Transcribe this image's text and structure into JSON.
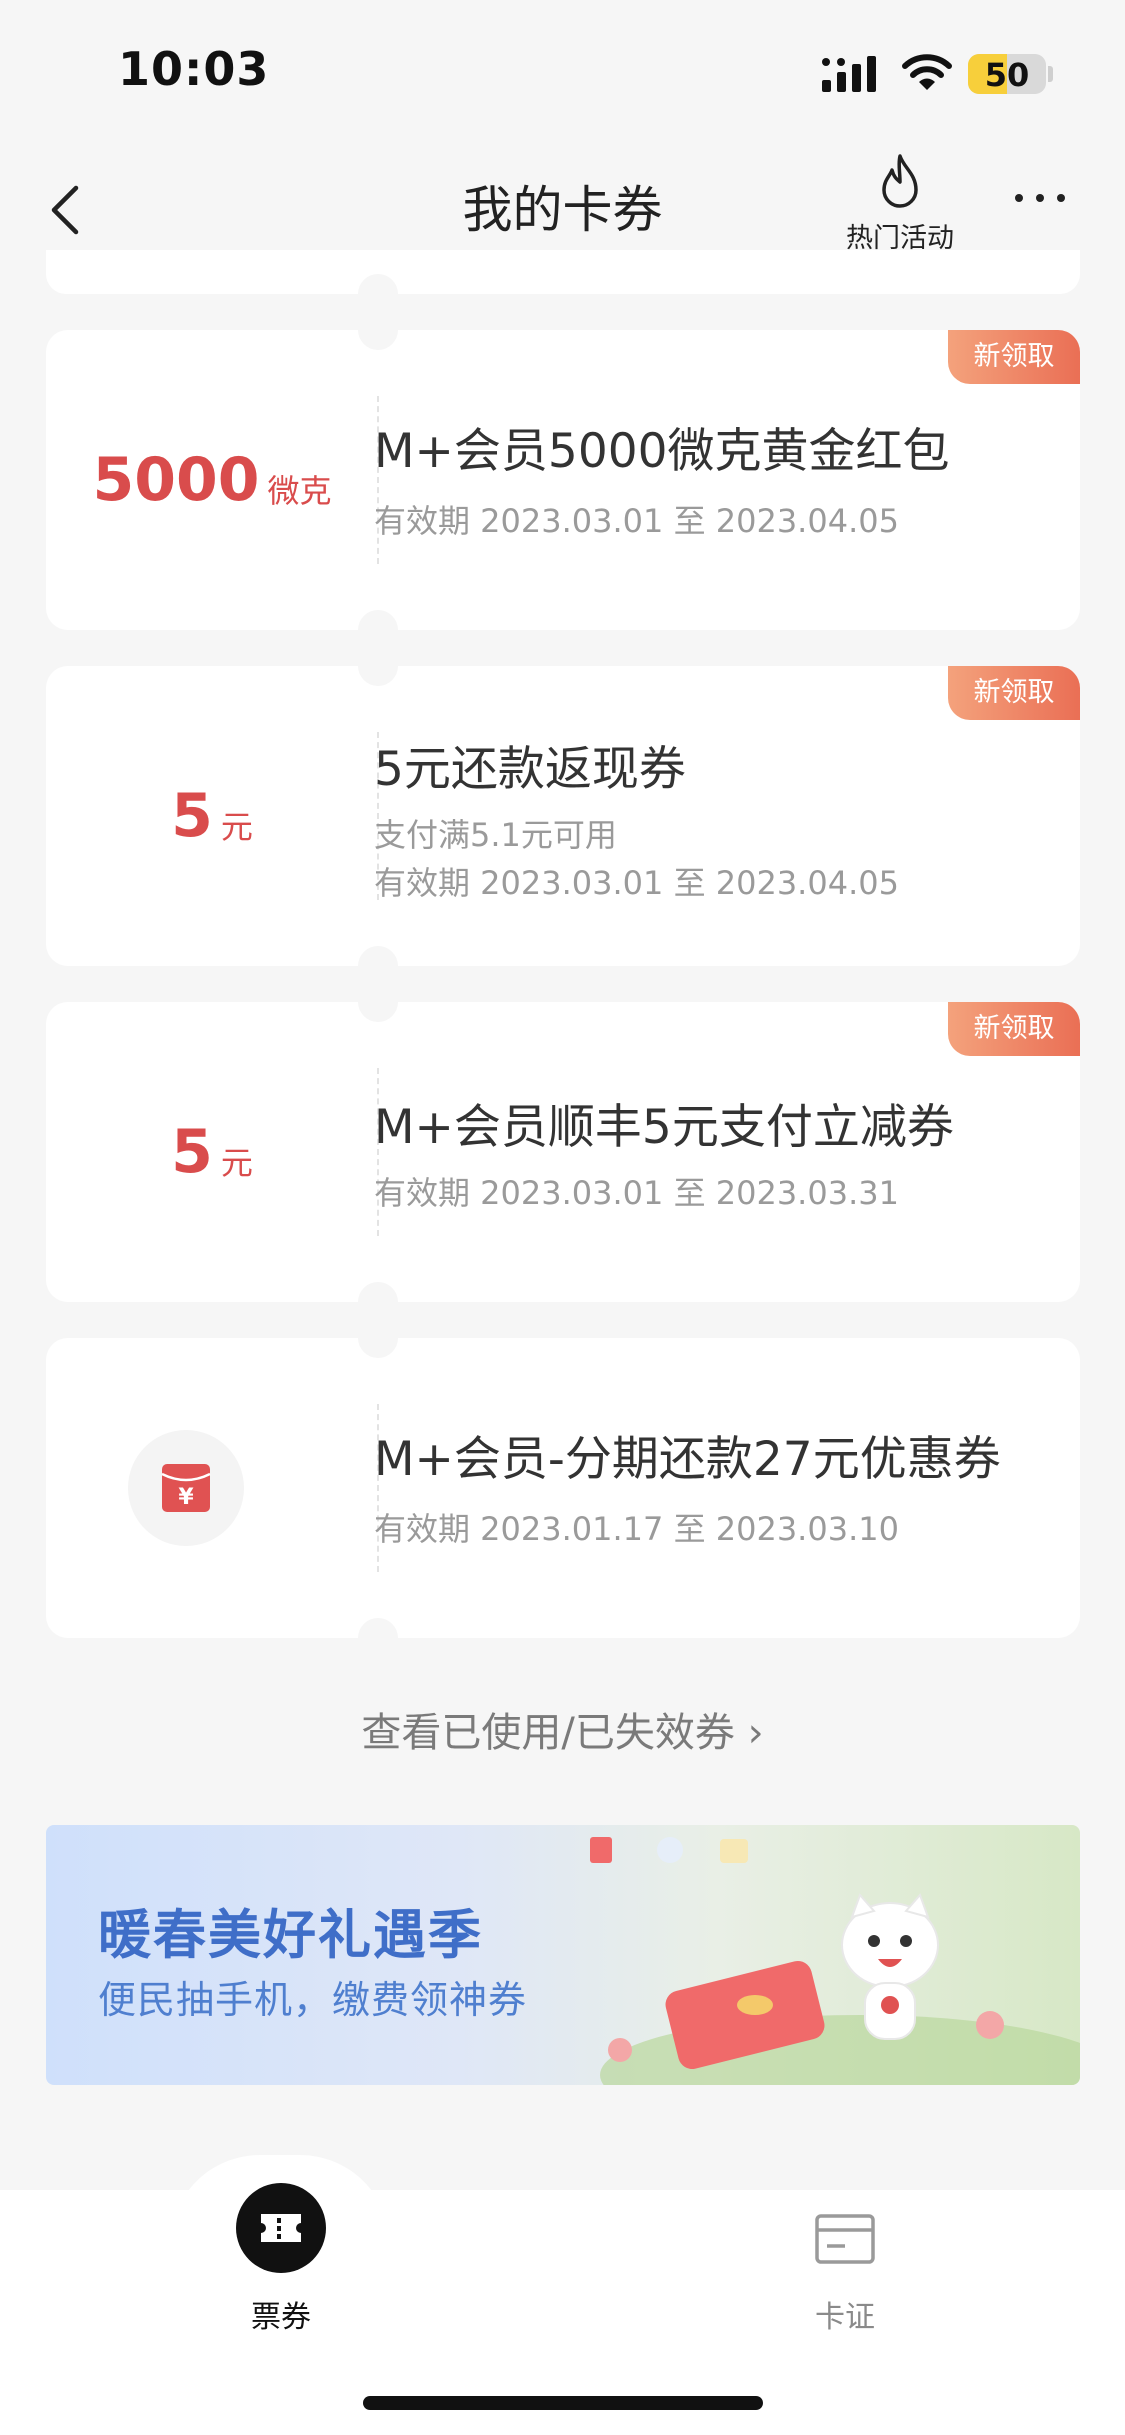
{
  "status_bar": {
    "time": "10:03",
    "battery": "50",
    "battery_level": 0.5
  },
  "nav": {
    "title": "我的卡券",
    "hot_label": "热门活动"
  },
  "coupons": [
    {
      "badge": "新领取",
      "amount": "5000",
      "unit": "微克",
      "title": "M+会员5000微克黄金红包",
      "condition": "",
      "validity": "有效期 2023.03.01 至 2023.04.05"
    },
    {
      "badge": "新领取",
      "amount": "5",
      "unit": "元",
      "title": "5元还款返现券",
      "condition": "支付满5.1元可用",
      "validity": "有效期 2023.03.01 至 2023.04.05"
    },
    {
      "badge": "新领取",
      "amount": "5",
      "unit": "元",
      "title": "M+会员顺丰5元支付立减券",
      "condition": "",
      "validity": "有效期 2023.03.01 至 2023.03.31"
    },
    {
      "badge": "",
      "amount": "",
      "unit": "",
      "title": "M+会员-分期还款27元优惠券",
      "condition": "",
      "validity": "有效期 2023.01.17 至 2023.03.10"
    }
  ],
  "view_used": "查看已使用/已失效券 ›",
  "banner": {
    "title": "暖春美好礼遇季",
    "subtitle": "便民抽手机，缴费领神券"
  },
  "tabs": [
    {
      "label": "票券",
      "active": true
    },
    {
      "label": "卡证",
      "active": false
    }
  ],
  "colors": {
    "accent_red": "#d94c4c",
    "badge": "#ea6f55",
    "banner_text": "#3f6ec8"
  }
}
